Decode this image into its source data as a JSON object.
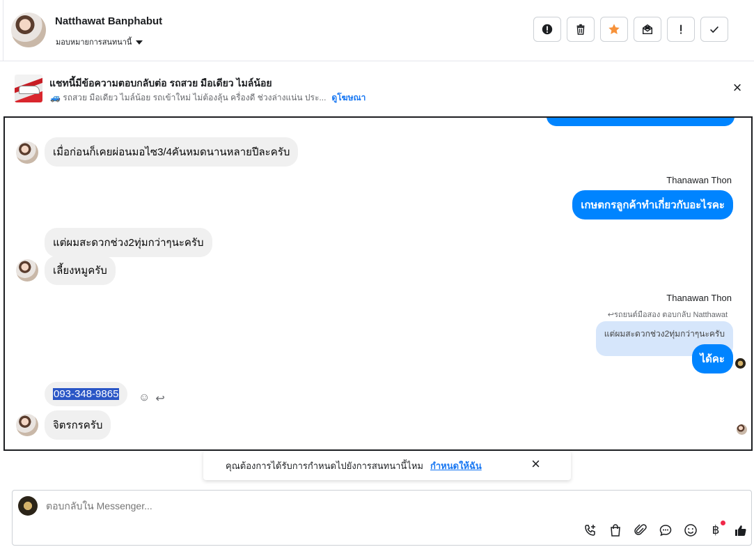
{
  "header": {
    "contact_name": "Natthawat Banphabut",
    "assign_label": "มอบหมายการสนทนานี้",
    "actions": [
      {
        "name": "spam-button",
        "icon": "alert-circle-icon"
      },
      {
        "name": "delete-button",
        "icon": "trash-icon"
      },
      {
        "name": "star-button",
        "icon": "star-icon",
        "color": "#f7923a"
      },
      {
        "name": "mark-unread-button",
        "icon": "envelope-icon"
      },
      {
        "name": "follow-up-button",
        "icon": "exclamation-icon"
      },
      {
        "name": "done-button",
        "icon": "check-icon"
      }
    ]
  },
  "ad": {
    "title": "แชทนี้มีข้อความตอบกลับต่อ รถสวย มือเดียว ไมล์น้อย",
    "subtitle": "🚙 รถสวย มือเดียว ไมล์น้อย รถเข้าใหม่ ไม่ต้องลุ้น ครื่องดี ช่วงล่างแน่น ประ...",
    "link": "ดูโฆษณา"
  },
  "thread": {
    "msg1": "เมื่อก่อนก็เคยผ่อนมอไซ3/4คันหมดนานหลายปีละครับ",
    "sender1": "Thanawan Thon",
    "msg2": "เกษตกรลูกค้าทำเกี่ยวกับอะไรคะ",
    "msg3": "แต่ผมสะดวกช่วง2ทุ่มกว่าๆนะครับ",
    "msg4": "เลี้ยงหมูครับ",
    "sender2": "Thanawan Thon",
    "reply_note": "↩รถยนต์มือสอง ตอบกลับ Natthawat",
    "quoted": "แต่ผมสะดวกช่วง2ทุ่มกว่าๆนะครับ",
    "msg5": "ได้คะ",
    "msg6": "093-348-9865",
    "msg7": "จิตรกรครับ"
  },
  "notice": {
    "text": "คุณต้องการได้รับการกำหนดไปยังการสนทนานี้ไหม",
    "link": "กำหนดให้ฉัน"
  },
  "composer": {
    "placeholder": "ตอบกลับใน Messenger...",
    "tools": [
      "phone-plus-icon",
      "shopping-bag-icon",
      "paperclip-icon",
      "chat-bubble-icon",
      "emoji-icon",
      "baht-icon",
      "thumbs-up-icon"
    ]
  }
}
